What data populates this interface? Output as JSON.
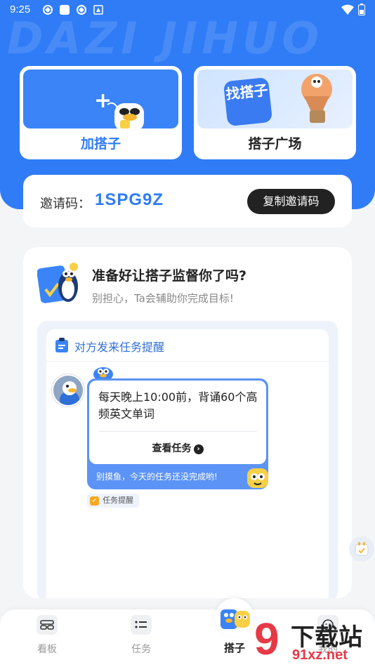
{
  "status_bar": {
    "time": "9:25"
  },
  "header": {
    "watermark": "DAZI JIHUO"
  },
  "cards": {
    "add_partner": "加搭子",
    "partner_square": "搭子广场",
    "find_partner_art": "找搭子"
  },
  "invite": {
    "label": "邀请码：",
    "code": "1SPG9Z",
    "copy_button": "复制邀请码"
  },
  "intro": {
    "title": "准备好让搭子监督你了吗?",
    "subtitle": "别担心，Ta会辅助你完成目标!"
  },
  "reminder": {
    "header": "对方发来任务提醒",
    "message": "每天晚上10:00前，背诵60个高频英文单词",
    "view_link": "查看任务",
    "footer": "别摸鱼，今天的任务还没完成哟!",
    "tag": "任务提醒"
  },
  "bottom_nav": {
    "items": [
      {
        "label": "看板",
        "icon": "dashboard-icon"
      },
      {
        "label": "任务",
        "icon": "task-list-icon"
      },
      {
        "label": "搭子",
        "icon": "partner-icon"
      },
      {
        "label": "我的",
        "icon": "profile-icon"
      }
    ]
  },
  "watermark_logo": {
    "mark": "9",
    "text": "下载站",
    "url": "91xz.net"
  },
  "colors": {
    "primary": "#2f7cf6",
    "dark_button": "#222222",
    "logo_red": "#e63946"
  }
}
